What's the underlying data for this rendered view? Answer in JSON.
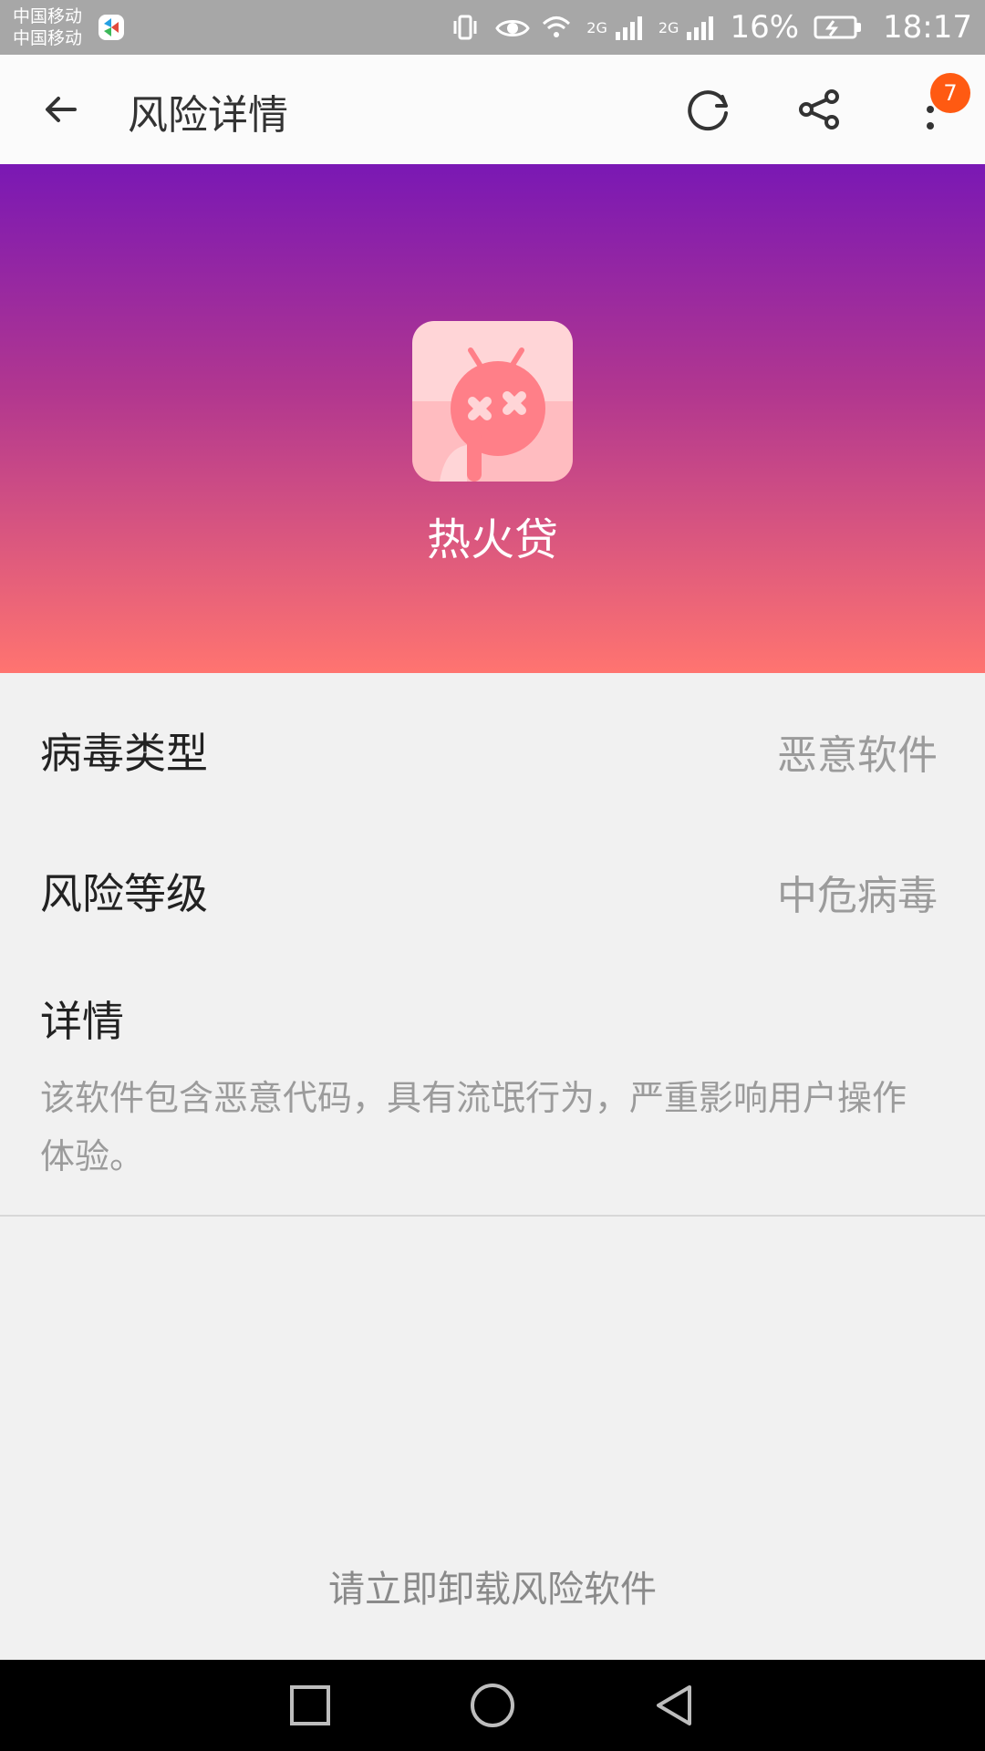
{
  "status_bar": {
    "carrier_1": "中国移动",
    "carrier_2": "中国移动",
    "battery": "16%",
    "time": "18:17",
    "network_1": "2G",
    "network_2": "2G",
    "icons": [
      "app-logo-icon",
      "vibrate-icon",
      "eye-icon",
      "wifi-icon",
      "signal-icon",
      "signal-icon",
      "battery-charging-icon"
    ]
  },
  "app_bar": {
    "title": "风险详情",
    "badge_count": "7"
  },
  "hero": {
    "app_name": "热火贷",
    "gradient_top": "#7a18b4",
    "gradient_bottom": "#ff7470"
  },
  "rows": [
    {
      "label": "病毒类型",
      "value": "恶意软件"
    },
    {
      "label": "风险等级",
      "value": "中危病毒"
    }
  ],
  "details": {
    "label": "详情",
    "description": "该软件包含恶意代码，具有流氓行为，严重影响用户操作体验。"
  },
  "footer": {
    "note": "请立即卸载风险软件"
  },
  "colors": {
    "badge": "#ff5a12",
    "text_primary": "#222222",
    "text_secondary": "#9b9b9b"
  }
}
